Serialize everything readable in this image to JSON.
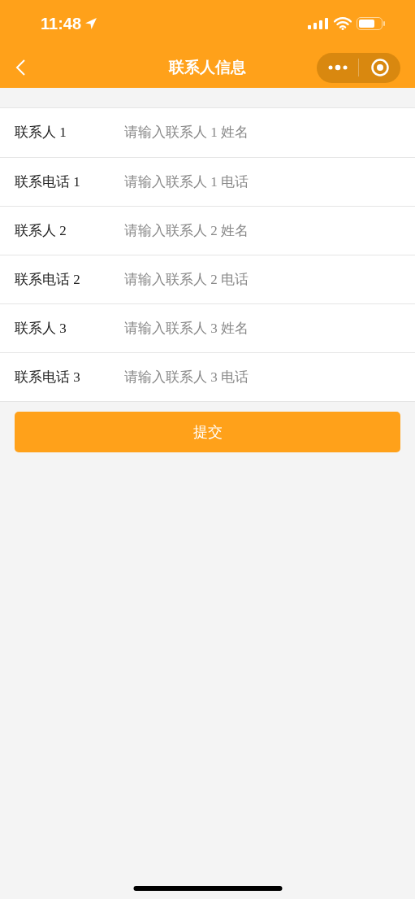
{
  "status_bar": {
    "time": "11:48"
  },
  "nav_bar": {
    "title": "联系人信息"
  },
  "fields": [
    {
      "label": "联系人 1",
      "placeholder": "请输入联系人 1 姓名"
    },
    {
      "label": "联系电话 1",
      "placeholder": "请输入联系人 1 电话"
    },
    {
      "label": "联系人 2",
      "placeholder": "请输入联系人 2 姓名"
    },
    {
      "label": "联系电话 2",
      "placeholder": "请输入联系人 2 电话"
    },
    {
      "label": "联系人 3",
      "placeholder": "请输入联系人 3 姓名"
    },
    {
      "label": "联系电话 3",
      "placeholder": "请输入联系人 3 电话"
    }
  ],
  "submit_button": "提交"
}
